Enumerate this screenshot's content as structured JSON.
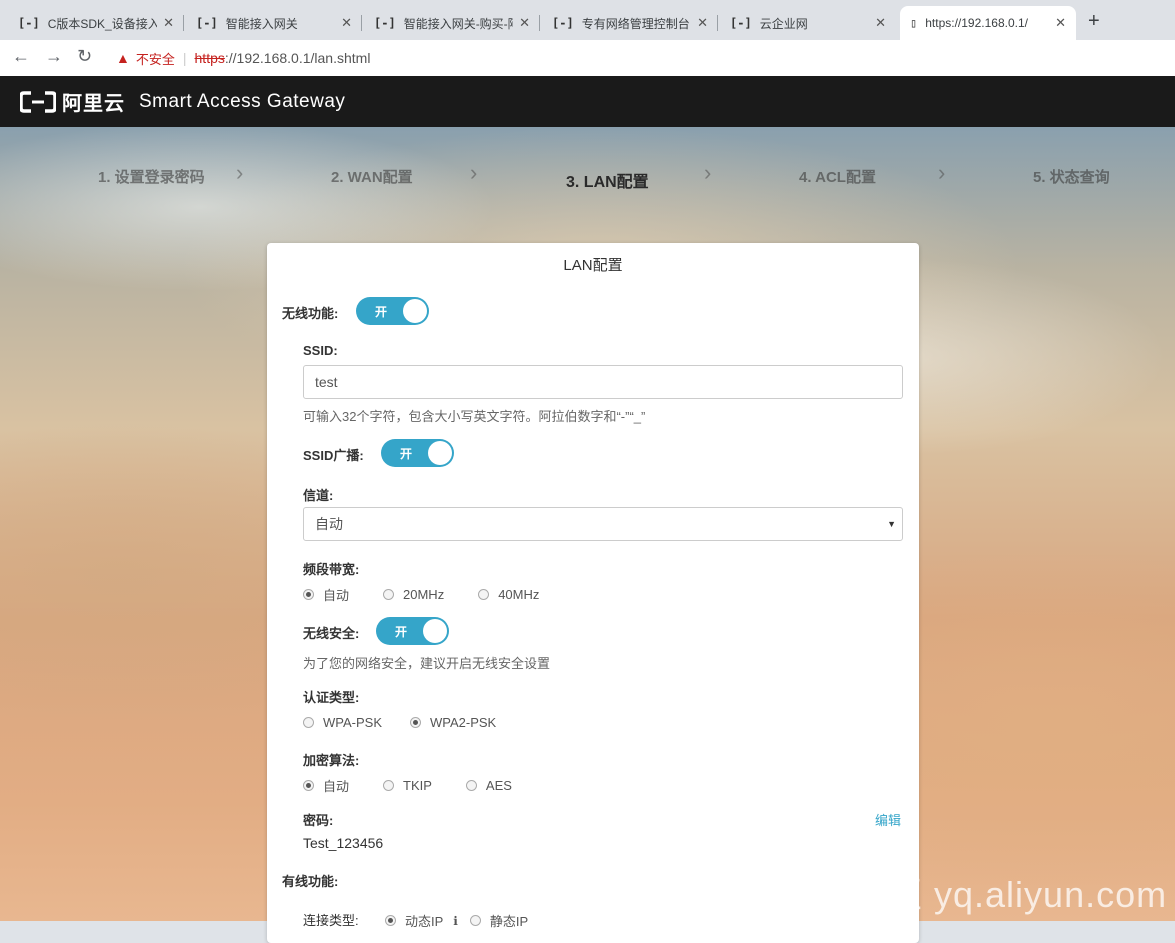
{
  "browser": {
    "tabs": [
      {
        "title": "C版本SDK_设备接入 "
      },
      {
        "title": "智能接入网关"
      },
      {
        "title": "智能接入网关-购买-阿"
      },
      {
        "title": "专有网络管理控制台"
      },
      {
        "title": "云企业网"
      },
      {
        "title": "https://192.168.0.1/"
      }
    ],
    "new_tab": "+",
    "address": {
      "insecure_label": "不安全",
      "protocol": "https",
      "rest_host": "://192.168.0.1",
      "path": "/lan.shtml"
    }
  },
  "header": {
    "brand_cn": "阿里云",
    "product": "Smart Access Gateway"
  },
  "steps": [
    {
      "label": "1. 设置登录密码"
    },
    {
      "label": "2. WAN配置"
    },
    {
      "label": "3. LAN配置"
    },
    {
      "label": "4. ACL配置"
    },
    {
      "label": "5. 状态查询"
    }
  ],
  "form": {
    "title": "LAN配置",
    "wireless": {
      "label": "无线功能:",
      "toggle_text": "开",
      "on": true
    },
    "ssid": {
      "label": "SSID:",
      "value": "test",
      "hint": "可输入32个字符，包含大小写英文字符。阿拉伯数字和“-”“_”"
    },
    "ssid_broadcast": {
      "label": "SSID广播:",
      "toggle_text": "开",
      "on": true
    },
    "channel": {
      "label": "信道:",
      "value": "自动"
    },
    "bandwidth": {
      "label": "频段带宽:",
      "options": [
        "自动",
        "20MHz",
        "40MHz"
      ],
      "selected": 0
    },
    "wireless_security": {
      "label": "无线安全:",
      "toggle_text": "开",
      "on": true,
      "hint": "为了您的网络安全，建议开启无线安全设置"
    },
    "auth_type": {
      "label": "认证类型:",
      "options": [
        "WPA-PSK",
        "WPA2-PSK"
      ],
      "selected": 1
    },
    "encryption": {
      "label": "加密算法:",
      "options": [
        "自动",
        "TKIP",
        "AES"
      ],
      "selected": 0
    },
    "password": {
      "label": "密码:",
      "value": "Test_123456",
      "edit": "编辑"
    },
    "wired": {
      "label": "有线功能:"
    },
    "connection_type": {
      "label": "连接类型:",
      "options": [
        "动态IP",
        "静态IP"
      ],
      "selected": 0
    }
  },
  "watermark": "云栖社区 yq.aliyun.com"
}
